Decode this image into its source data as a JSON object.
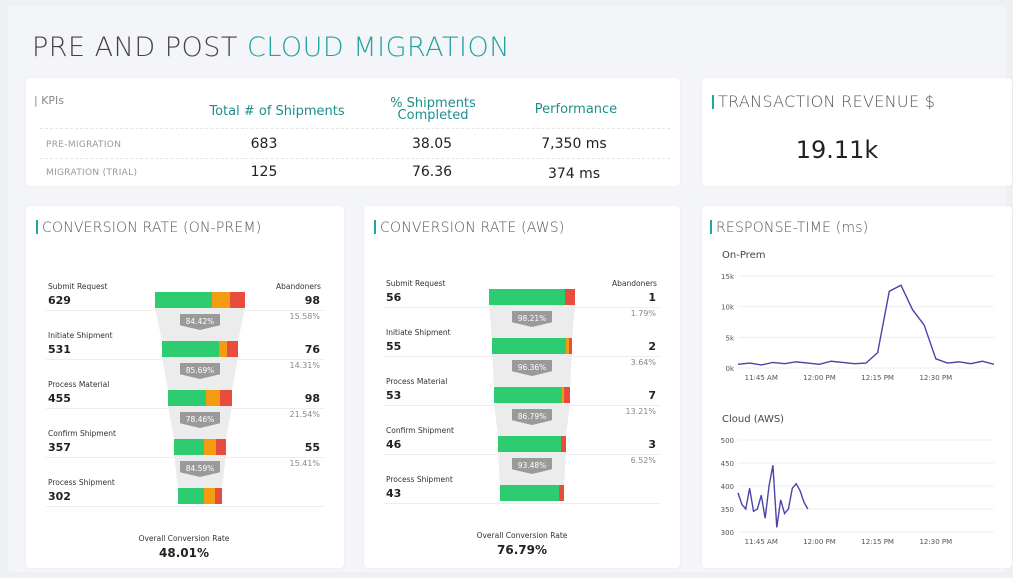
{
  "title": {
    "part1": "PRE AND POST",
    "part2": "CLOUD MIGRATION"
  },
  "kpi": {
    "label": "KPIs",
    "columns": [
      "Total # of Shipments",
      "% Shipments Completed",
      "Performance"
    ],
    "rows": [
      {
        "label": "PRE-MIGRATION",
        "values": [
          "683",
          "38.05",
          "7,350 ms"
        ]
      },
      {
        "label": "MIGRATION (TRIAL)",
        "values": [
          "125",
          "76.36",
          "374 ms"
        ]
      }
    ]
  },
  "revenue": {
    "label": "TRANSACTION REVENUE $",
    "value": "19.11k"
  },
  "onprem": {
    "label": "CONVERSION RATE (ON-PREM)",
    "abandoners_label": "Abandoners",
    "stages": [
      {
        "name": "Submit Request",
        "value": "629",
        "aband": "98",
        "aband_pct": "15.58%",
        "rate": "84.42%",
        "segs": [
          0.63,
          0.2,
          0.17
        ]
      },
      {
        "name": "Initiate Shipment",
        "value": "531",
        "aband": "76",
        "aband_pct": "14.31%",
        "rate": "85.69%",
        "segs": [
          0.75,
          0.1,
          0.15
        ]
      },
      {
        "name": "Process Material",
        "value": "455",
        "aband": "98",
        "aband_pct": "21.54%",
        "rate": "78.46%",
        "segs": [
          0.6,
          0.22,
          0.18
        ]
      },
      {
        "name": "Confirm Shipment",
        "value": "357",
        "aband": "55",
        "aband_pct": "15.41%",
        "rate": "84.59%",
        "segs": [
          0.58,
          0.22,
          0.2
        ]
      },
      {
        "name": "Process Shipment",
        "value": "302",
        "aband": "",
        "aband_pct": "",
        "rate": "",
        "segs": [
          0.6,
          0.25,
          0.15
        ]
      }
    ],
    "overall_label": "Overall Conversion Rate",
    "overall_value": "48.01%"
  },
  "aws": {
    "label": "CONVERSION RATE (AWS)",
    "abandoners_label": "Abandoners",
    "stages": [
      {
        "name": "Submit Request",
        "value": "56",
        "aband": "1",
        "aband_pct": "1.79%",
        "rate": "98.21%",
        "segs": [
          0.88,
          0.0,
          0.12
        ]
      },
      {
        "name": "Initiate Shipment",
        "value": "55",
        "aband": "2",
        "aband_pct": "3.64%",
        "rate": "96.36%",
        "segs": [
          0.93,
          0.03,
          0.04
        ]
      },
      {
        "name": "Process Material",
        "value": "53",
        "aband": "7",
        "aband_pct": "13.21%",
        "rate": "86.79%",
        "segs": [
          0.9,
          0.02,
          0.08
        ]
      },
      {
        "name": "Confirm Shipment",
        "value": "46",
        "aband": "3",
        "aband_pct": "6.52%",
        "rate": "93.48%",
        "segs": [
          0.93,
          0.0,
          0.07
        ]
      },
      {
        "name": "Process Shipment",
        "value": "43",
        "aband": "",
        "aband_pct": "",
        "rate": "",
        "segs": [
          0.92,
          0.0,
          0.08
        ]
      }
    ],
    "overall_label": "Overall Conversion Rate",
    "overall_value": "76.79%"
  },
  "response": {
    "label": "RESPONSE-TIME (ms)",
    "colors": {
      "line": "#4b44a8",
      "accent": "#21a3a0"
    },
    "chart_data": [
      {
        "type": "line",
        "title": "On-Prem",
        "x_ticks": [
          "11:45 AM",
          "12:00 PM",
          "12:15 PM",
          "12:30 PM"
        ],
        "y_ticks": [
          "0k",
          "5k",
          "10k",
          "15k"
        ],
        "ylim": [
          0,
          15000
        ],
        "x_minutes": [
          0,
          3,
          6,
          9,
          12,
          15,
          18,
          21,
          24,
          27,
          30,
          33,
          36,
          39,
          42,
          45,
          48,
          51,
          54,
          57,
          60,
          63,
          66
        ],
        "values": [
          600,
          800,
          500,
          900,
          700,
          1000,
          800,
          600,
          1100,
          900,
          700,
          800,
          2500,
          12500,
          13500,
          9500,
          7000,
          1500,
          800,
          1000,
          700,
          1100,
          600
        ]
      },
      {
        "type": "line",
        "title": "Cloud (AWS)",
        "x_ticks": [
          "11:45 AM",
          "12:00 PM",
          "12:15 PM",
          "12:30 PM"
        ],
        "y_ticks": [
          "300",
          "350",
          "400",
          "450",
          "500"
        ],
        "ylim": [
          300,
          500
        ],
        "x_minutes": [
          0,
          1,
          2,
          3,
          4,
          5,
          6,
          7,
          8,
          9,
          10,
          11,
          12,
          13,
          14,
          15,
          16,
          17,
          18
        ],
        "values": [
          385,
          360,
          350,
          395,
          345,
          350,
          380,
          330,
          400,
          445,
          310,
          370,
          340,
          350,
          395,
          405,
          390,
          365,
          350
        ]
      }
    ]
  }
}
